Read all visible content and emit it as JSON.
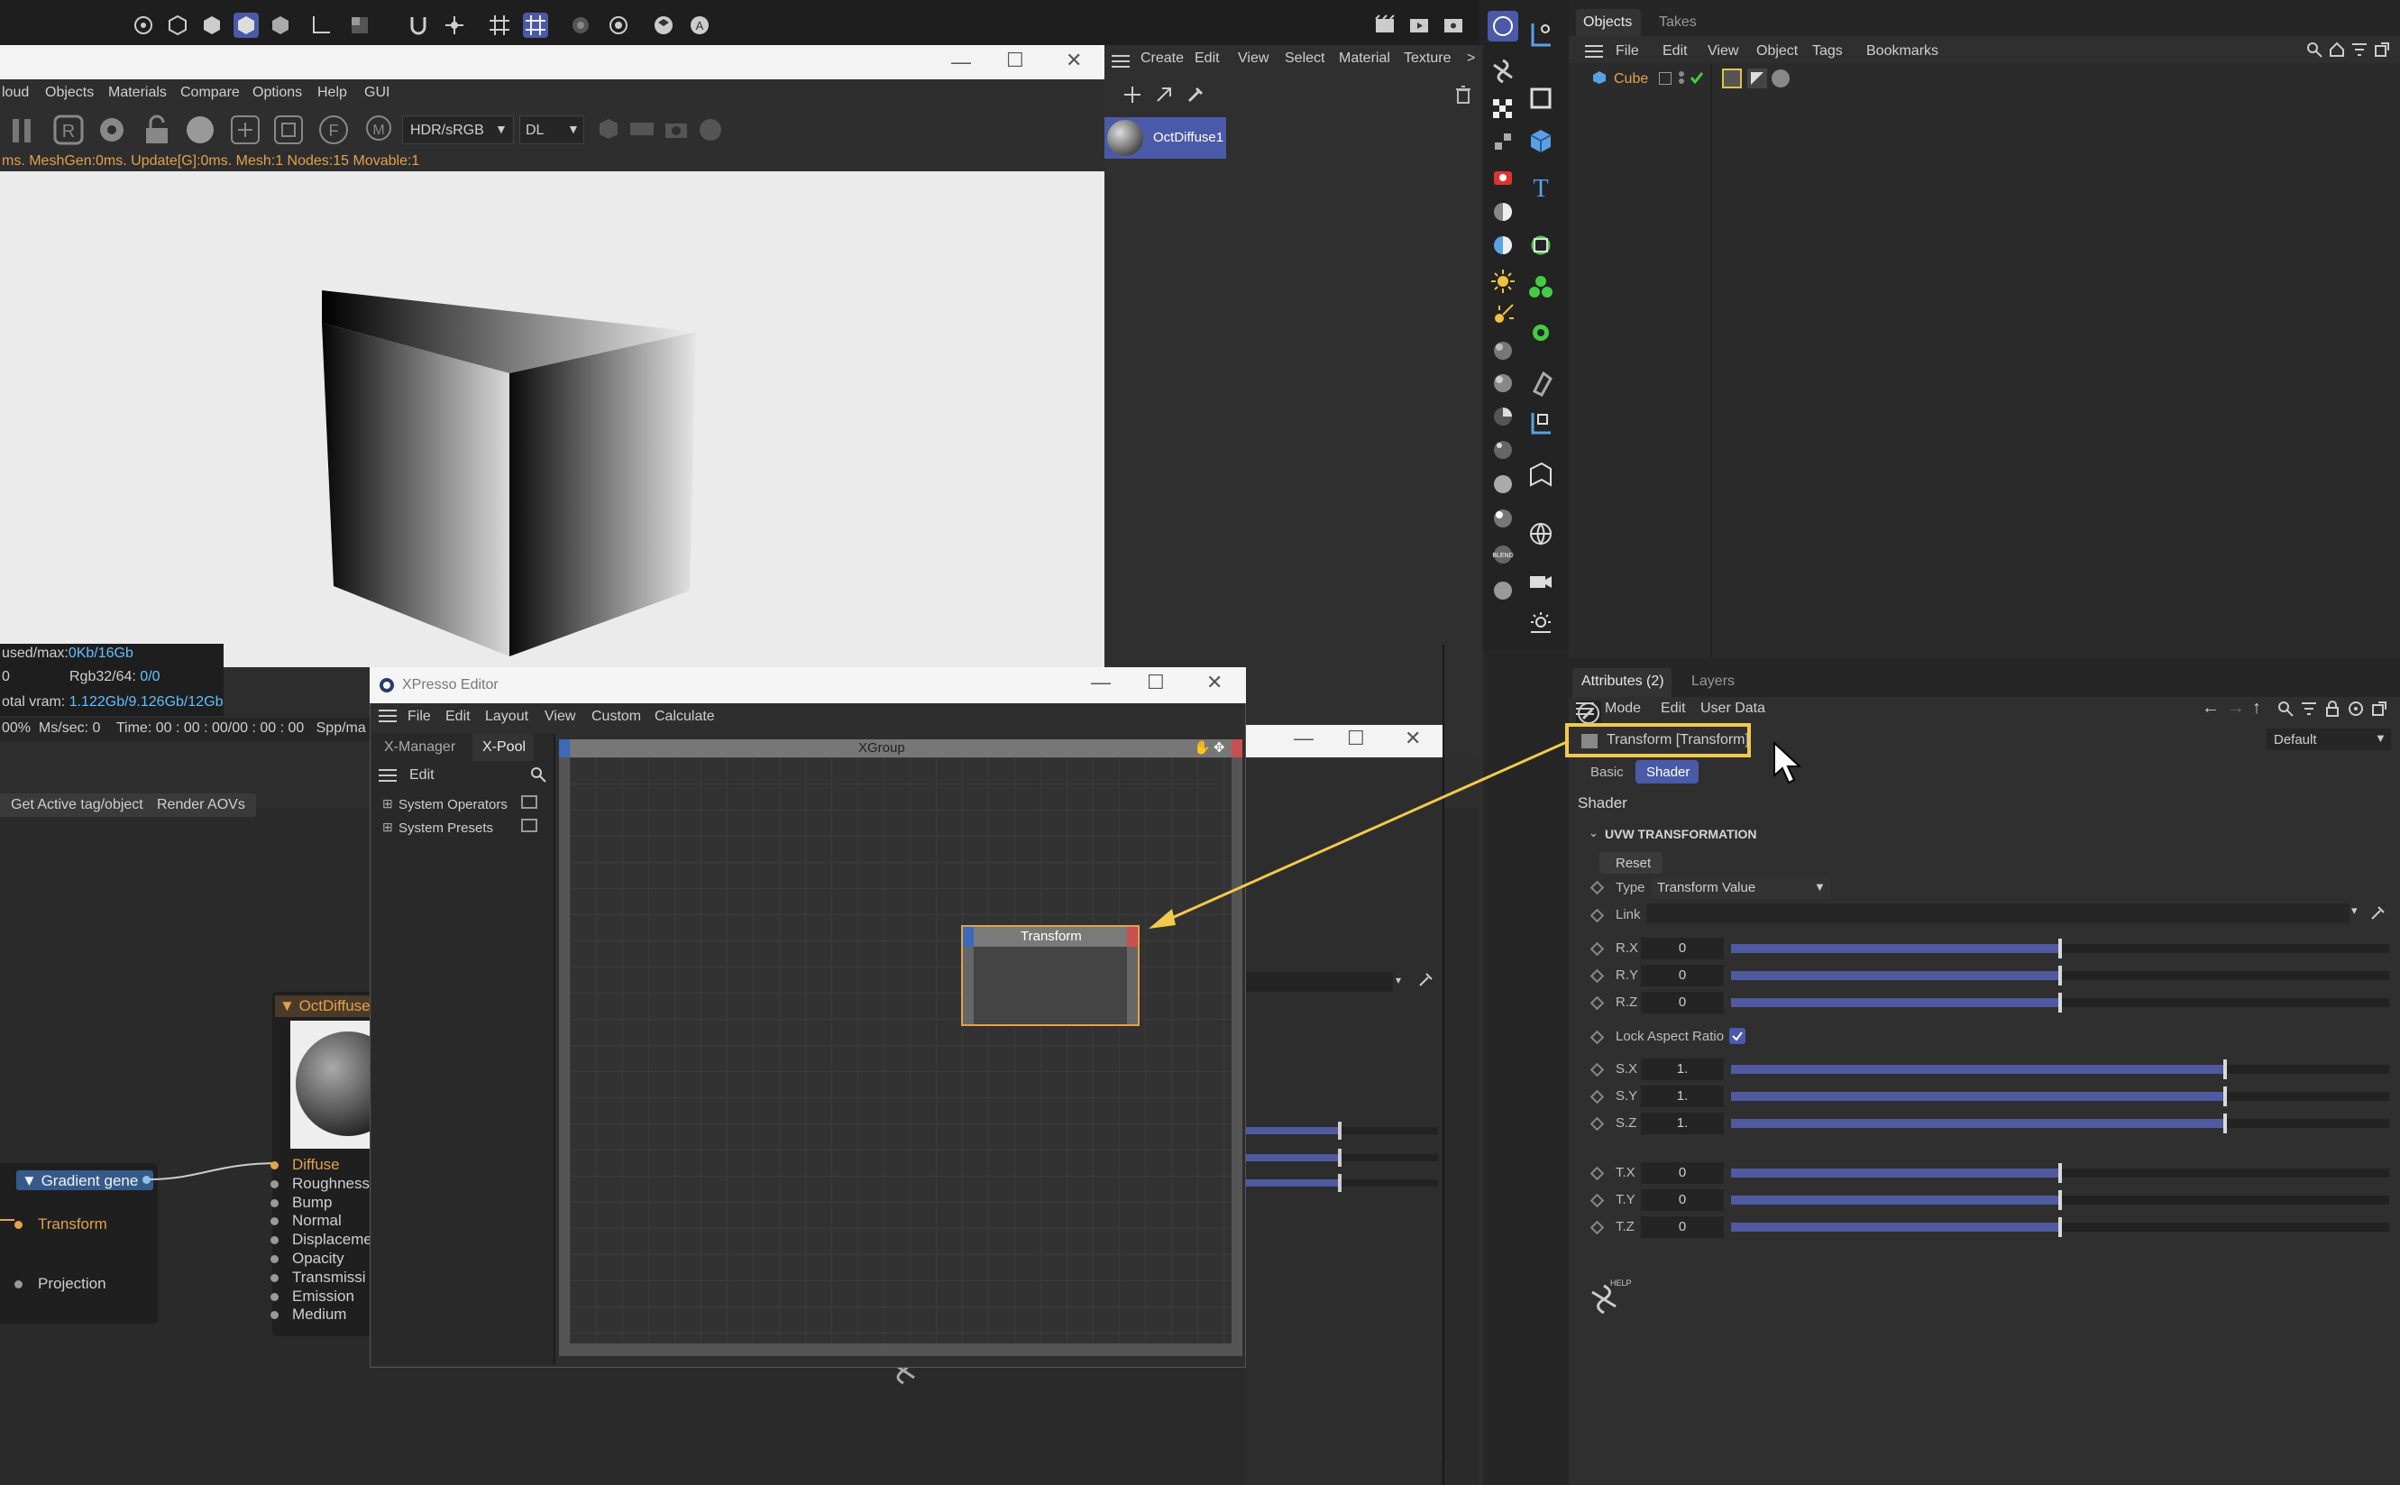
{
  "renderer": {
    "title_buttons": [
      "—",
      "☐",
      "✕"
    ],
    "menu": [
      "loud",
      "Objects",
      "Materials",
      "Compare",
      "Options",
      "Help",
      "GUI"
    ],
    "hdr_select": "HDR/sRGB",
    "dl_select": "DL",
    "status_line": "ms. MeshGen:0ms. Update[G]:0ms. Mesh:1 Nodes:15 Movable:1",
    "mem_label": "used/max:",
    "mem_value": "0Kb/16Gb",
    "rgb_zero": "0",
    "rgb_label": "Rgb32/64:",
    "rgb_value": "0/0",
    "vram_label": "otal vram:",
    "vram_value": "1.122Gb/9.126Gb/12Gb",
    "bottom_status": "00%  Ms/sec: 0    Time: 00 : 00 : 00/00 : 00 : 00   Spp/ma"
  },
  "material_manager": {
    "menu": [
      "Create",
      "Edit",
      "View",
      "Select",
      "Material",
      "Texture",
      ">"
    ],
    "material_name": "OctDiffuse1"
  },
  "objects_panel": {
    "tabs": [
      "Objects",
      "Takes"
    ],
    "menu": [
      "File",
      "Edit",
      "View",
      "Object",
      "Tags",
      "Bookmarks"
    ],
    "object_name": "Cube"
  },
  "attributes": {
    "tabs": [
      "Attributes (2)",
      "Layers"
    ],
    "menu": [
      "Mode",
      "Edit",
      "User Data"
    ],
    "shader_title": "Transform [Transform]",
    "preset": "Default",
    "subtabs": [
      "Basic",
      "Shader"
    ],
    "section_label": "Shader",
    "group_title": "UVW TRANSFORMATION",
    "reset": "Reset",
    "type_label": "Type",
    "type_value": "Transform Value",
    "link_label": "Link",
    "lock_label": "Lock Aspect Ratio",
    "lock_checked": true,
    "rows": [
      {
        "label": "R.X",
        "value": "0",
        "level": 0.5
      },
      {
        "label": "R.Y",
        "value": "0",
        "level": 0.5
      },
      {
        "label": "R.Z",
        "value": "0",
        "level": 0.5
      },
      {
        "label": "S.X",
        "value": "1.",
        "level": 0.75
      },
      {
        "label": "S.Y",
        "value": "1.",
        "level": 0.75
      },
      {
        "label": "S.Z",
        "value": "1.",
        "level": 0.75
      },
      {
        "label": "T.X",
        "value": "0",
        "level": 0.5
      },
      {
        "label": "T.Y",
        "value": "0",
        "level": 0.5
      },
      {
        "label": "T.Z",
        "value": "0",
        "level": 0.5
      }
    ],
    "help": "HELP"
  },
  "node_editor": {
    "buttons": [
      "Get Active tag/object",
      "Render AOVs"
    ],
    "gradient_node": "Gradient gene",
    "gradient_ports": [
      "Transform",
      "Projection"
    ],
    "diffuse_node": "OctDiffuse",
    "diffuse_ports": [
      "Diffuse",
      "Roughness",
      "Bump",
      "Normal",
      "Displaceme",
      "Opacity",
      "Transmissi",
      "Emission",
      "Medium"
    ]
  },
  "xpresso": {
    "title": "XPresso Editor",
    "menu": [
      "File",
      "Edit",
      "Layout",
      "View",
      "Custom",
      "Calculate"
    ],
    "tabs": [
      "X-Manager",
      "X-Pool"
    ],
    "edit_label": "Edit",
    "tree": [
      "System Operators",
      "System Presets"
    ],
    "group_title": "XGroup",
    "node_title": "Transform"
  },
  "colors": {
    "accent": "#4a5aa8",
    "highlight": "#f2c94c",
    "orange": "#e3a14a"
  }
}
